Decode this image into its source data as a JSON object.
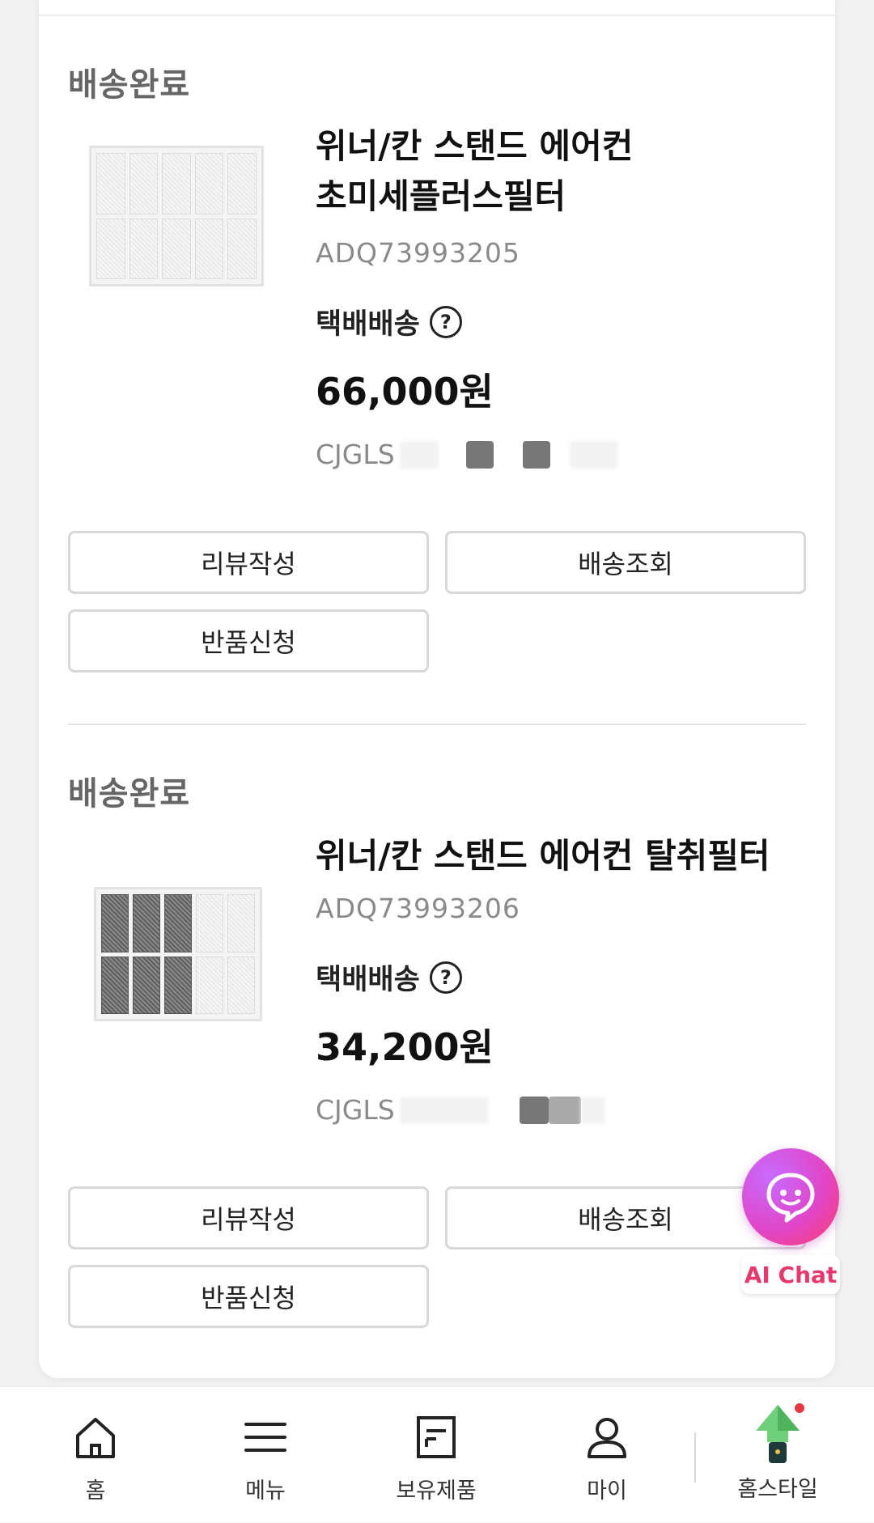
{
  "orders": [
    {
      "status": "배송완료",
      "title_lines": [
        "위너/칸 스탠드 에어컨",
        "초미세플러스필터"
      ],
      "product_code": "ADQ73993205",
      "shipping_method": "택배배송",
      "price": "66,000원",
      "tracking_prefix": "CJGLS",
      "buttons": {
        "review": "리뷰작성",
        "track": "배송조회",
        "return": "반품신청"
      }
    },
    {
      "status": "배송완료",
      "title_lines": [
        "위너/칸 스탠드 에어컨 탈취필터"
      ],
      "product_code": "ADQ73993206",
      "shipping_method": "택배배송",
      "price": "34,200원",
      "tracking_prefix": "CJGLS",
      "buttons": {
        "review": "리뷰작성",
        "track": "배송조회",
        "return": "반품신청"
      }
    }
  ],
  "help_icon_glyph": "?",
  "ai_chat": {
    "label": "AI Chat",
    "icon": "chat-bubble-icon",
    "colors": [
      "#c86bff",
      "#e046c8",
      "#ff3b6a"
    ]
  },
  "bottom_nav": [
    {
      "label": "홈",
      "icon": "home-icon"
    },
    {
      "label": "메뉴",
      "icon": "menu-icon"
    },
    {
      "label": "보유제품",
      "icon": "owned-products-icon"
    },
    {
      "label": "마이",
      "icon": "person-icon"
    },
    {
      "label": "홈스타일",
      "icon": "home-style-icon"
    }
  ],
  "colors": {
    "accent": "#e6386d",
    "status_text": "#666666",
    "border": "#d8d8d8"
  }
}
